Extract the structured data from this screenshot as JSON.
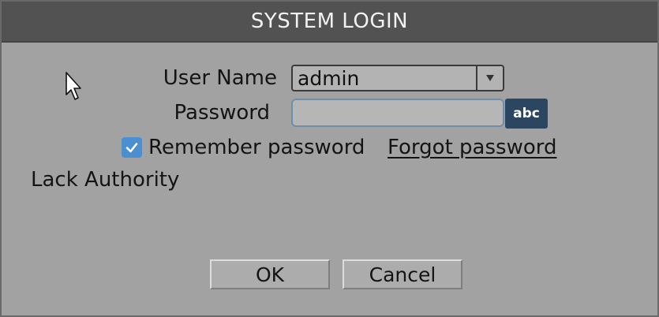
{
  "dialog": {
    "title": "SYSTEM LOGIN"
  },
  "form": {
    "username_label": "User Name",
    "username_value": "admin",
    "password_label": "Password",
    "password_value": "",
    "keyboard_mode": "abc",
    "remember_label": "Remember password",
    "remember_checked": true,
    "forgot_label": "Forgot password",
    "status_message": "Lack Authority"
  },
  "buttons": {
    "ok_label": "OK",
    "cancel_label": "Cancel"
  },
  "icons": {
    "dropdown": "chevron-down-icon",
    "checkmark": "checkmark-icon",
    "cursor": "mouse-pointer-icon"
  },
  "colors": {
    "titlebar_bg": "#525252",
    "dialog_bg": "#a2a2a2",
    "checkbox_accent": "#4a90d0",
    "keyboard_button_bg": "#2c4561"
  }
}
